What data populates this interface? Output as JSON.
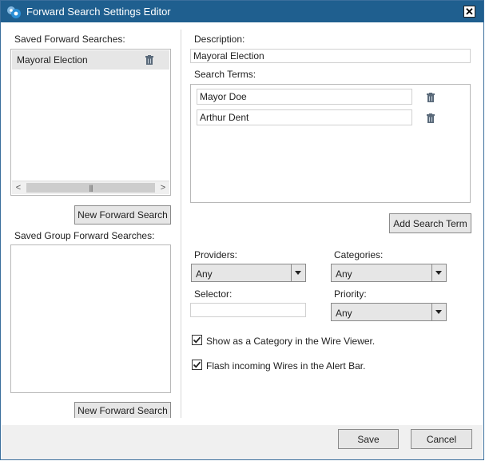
{
  "window": {
    "title": "Forward Search Settings Editor",
    "close_glyph": "✕"
  },
  "saved_searches": {
    "label": "Saved Forward Searches:",
    "items": [
      {
        "label": "Mayoral Election"
      }
    ],
    "new_button": "New Forward Search"
  },
  "group_searches": {
    "label": "Saved Group Forward Searches:",
    "new_button": "New Forward Search"
  },
  "description": {
    "label": "Description:",
    "value": "Mayoral Election"
  },
  "search_terms": {
    "label": "Search Terms:",
    "items": [
      {
        "value": "Mayor Doe"
      },
      {
        "value": "Arthur Dent"
      }
    ],
    "add_button": "Add Search Term"
  },
  "providers": {
    "label": "Providers:",
    "value": "Any"
  },
  "categories": {
    "label": "Categories:",
    "value": "Any"
  },
  "selector": {
    "label": "Selector:",
    "value": ""
  },
  "priority": {
    "label": "Priority:",
    "value": "Any"
  },
  "options": {
    "show_category": {
      "label": "Show as a Category in the Wire Viewer.",
      "checked": true
    },
    "flash_wires": {
      "label": "Flash incoming Wires in the Alert Bar.",
      "checked": true
    }
  },
  "footer": {
    "save": "Save",
    "cancel": "Cancel"
  },
  "colors": {
    "titlebar": "#1f5f8f",
    "accent_icon": "#2b8fd6",
    "trash": "#5a6a7a"
  }
}
